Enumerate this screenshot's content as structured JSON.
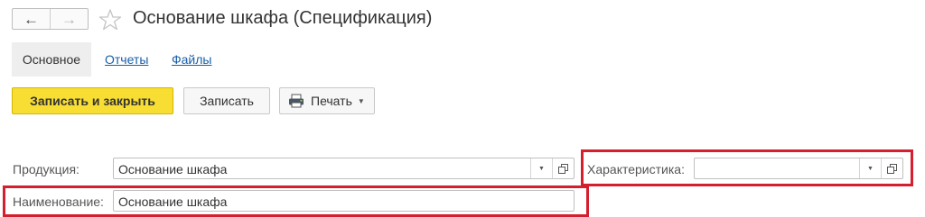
{
  "header": {
    "title": "Основание шкафа (Спецификация)",
    "nav_back_icon": "arrow-left",
    "nav_forward_icon": "arrow-right",
    "favorite_icon": "star-outline"
  },
  "tabs": {
    "main": "Основное",
    "reports": "Отчеты",
    "files": "Файлы"
  },
  "toolbar": {
    "save_close_label": "Записать и закрыть",
    "save_label": "Записать",
    "print_label": "Печать"
  },
  "form": {
    "product": {
      "label": "Продукция:",
      "value": "Основание шкафа"
    },
    "characteristic": {
      "label": "Характеристика:",
      "value": ""
    },
    "name": {
      "label": "Наименование:",
      "value": "Основание шкафа"
    }
  },
  "colors": {
    "accent_yellow": "#f8dd33",
    "link_blue": "#1a5fa8",
    "highlight_red": "#d41f2f"
  }
}
